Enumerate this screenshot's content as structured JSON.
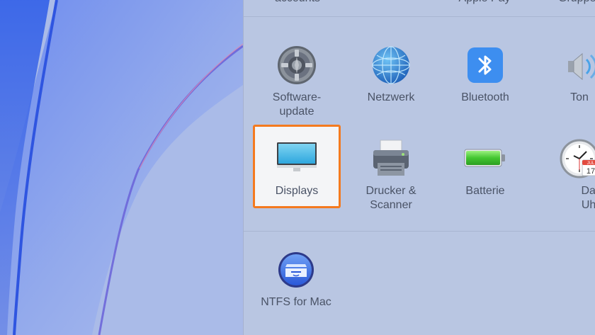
{
  "window": {
    "top_row_partial": [
      "accounts",
      "Apple Pay",
      "Gruppe"
    ]
  },
  "row1": [
    {
      "label": "Software-\nupdate",
      "icon": "gear-icon"
    },
    {
      "label": "Netzwerk",
      "icon": "globe-icon"
    },
    {
      "label": "Bluetooth",
      "icon": "bluetooth-icon"
    },
    {
      "label": "Ton",
      "icon": "speaker-icon"
    }
  ],
  "row2": [
    {
      "label": "Displays",
      "icon": "display-icon",
      "highlighted": true
    },
    {
      "label": "Drucker &\nScanner",
      "icon": "printer-icon"
    },
    {
      "label": "Batterie",
      "icon": "battery-icon"
    },
    {
      "label": "Datum\nUhrzei",
      "icon": "clock-icon"
    }
  ],
  "row3": [
    {
      "label": "NTFS for Mac",
      "icon": "ntfs-drive-icon"
    }
  ],
  "calendar_badge": {
    "month": "JUL",
    "day": "17"
  },
  "colors": {
    "highlight": "#f47a1f",
    "window_bg": "#b9c6e2"
  }
}
